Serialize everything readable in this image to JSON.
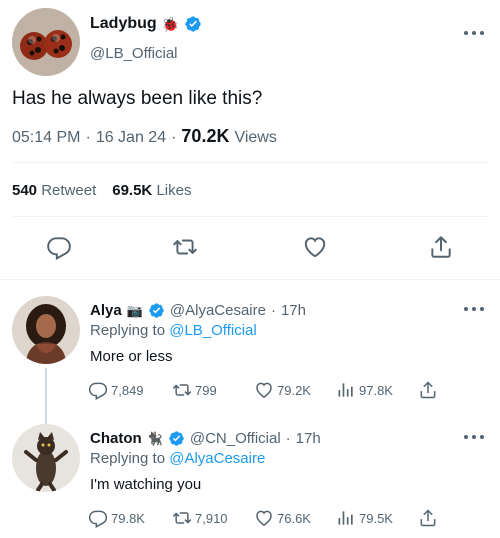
{
  "tweet": {
    "author_name": "Ladybug",
    "author_emoji": "🐞",
    "handle": "@LB_Official",
    "text": "Has he always been like this?",
    "time": "05:14 PM",
    "date": "16 Jan 24",
    "views_count": "70.2K",
    "views_label": "Views",
    "retweets_count": "540",
    "retweets_label": "Retweet",
    "likes_count": "69.5K",
    "likes_label": "Likes"
  },
  "replies": [
    {
      "name": "Alya",
      "emoji": "📷",
      "handle": "@AlyaCesaire",
      "time": "17h",
      "replying_prefix": "Replying to",
      "replying_to": "@LB_Official",
      "text": "More or less",
      "replies": "7,849",
      "retweets": "799",
      "likes": "79.2K",
      "views": "97.8K"
    },
    {
      "name": "Chaton",
      "emoji": "🐈‍⬛",
      "handle": "@CN_Official",
      "time": "17h",
      "replying_prefix": "Replying to",
      "replying_to": "@AlyaCesaire",
      "text": "I'm watching you",
      "replies": "79.8K",
      "retweets": "7,910",
      "likes": "76.6K",
      "views": "79.5K"
    }
  ],
  "icons": {
    "verified": "verified-badge-icon",
    "reply": "reply-icon",
    "retweet": "retweet-icon",
    "like": "heart-icon",
    "share": "share-icon",
    "views": "views-icon",
    "more": "more-icon"
  },
  "colors": {
    "accent": "#1d9bf0",
    "secondary_text": "#536471",
    "primary_text": "#0f1419"
  }
}
